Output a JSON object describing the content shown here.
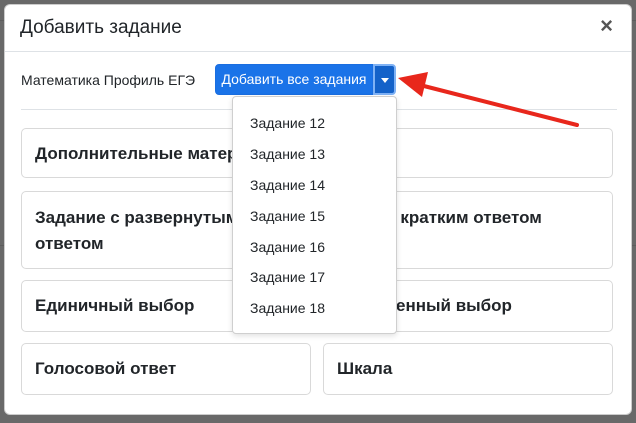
{
  "modal": {
    "title": "Добавить задание",
    "close_label": "×"
  },
  "subject": {
    "label": "Математика Профиль ЕГЭ",
    "add_all_label": "Добавить все задания"
  },
  "dropdown": {
    "items": [
      "Задание 12",
      "Задание 13",
      "Задание 14",
      "Задание 15",
      "Задание 16",
      "Задание 17",
      "Задание 18"
    ]
  },
  "cards": {
    "extra": "Дополнительные матер",
    "extended_line1": "Задание с развернутым",
    "extended_line2": "ответом",
    "short_answer": "е с кратким ответом",
    "single_choice": "Единичный выбор",
    "multiple_choice": "ственный выбор",
    "voice": "Голосовой ответ",
    "scale": "Шкала"
  },
  "colors": {
    "primary": "#1a73e8",
    "annotation_arrow": "#e8271c"
  }
}
